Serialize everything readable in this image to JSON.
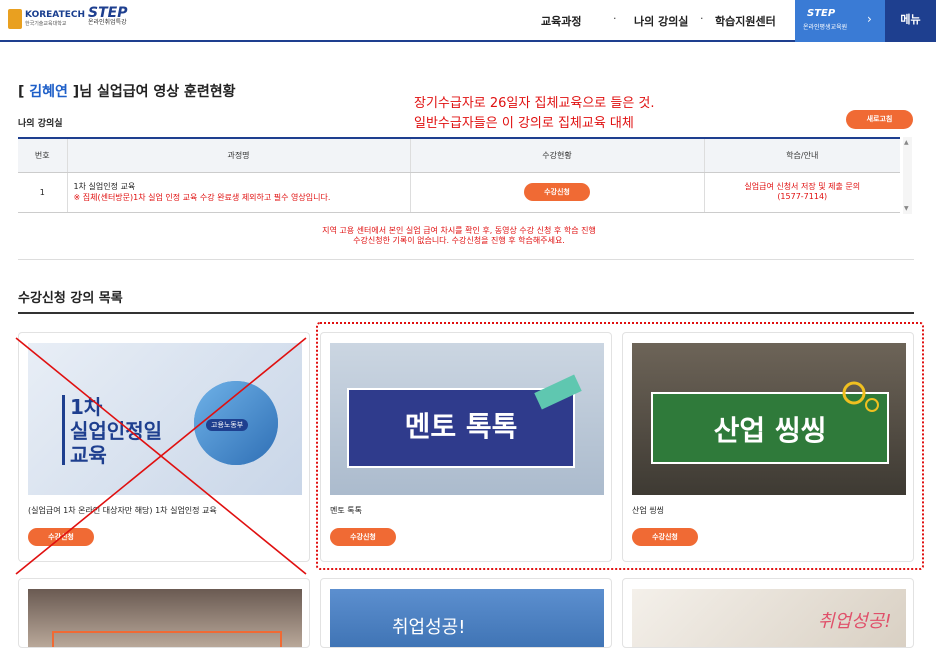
{
  "header": {
    "logo_koreatech": "KOREATECH",
    "logo_koreatech_sub": "한국기술교육대학교",
    "logo_step": "STEP",
    "logo_step_sub": "온라인취업특강",
    "nav": [
      "교육과정",
      "나의 강의실",
      "학습지원센터"
    ],
    "step_box": {
      "title": "STEP",
      "sub": "온라인평생교육원"
    },
    "menu": "메뉴",
    "accent": "#1e3f8f"
  },
  "page": {
    "name": "김혜연",
    "title_suffix": "님 실업급여 영상 훈련현황",
    "annotation": [
      "장기수급자로 26일자 집체교육으로 들은 것.",
      "일반수급자들은 이 강의로 집체교육 대체"
    ],
    "classroom_label": "나의 강의실",
    "refresh_button": "새로고침",
    "table": {
      "headers": [
        "번호",
        "과정명",
        "수강현황",
        "학습/안내"
      ],
      "rows": [
        {
          "no": "1",
          "course": "1차 실업인정 교육",
          "course_note": "※ 집체(센터방문)1차 실업 인정 교육 수강 완료생 제외하고 필수 영상입니다.",
          "status_button": "수강신청",
          "guide_line1": "실업급여 신청서 저장 및 제출 문의",
          "guide_line2": "(1577-7114)"
        }
      ]
    },
    "notice_line1": "지역 고용 센터에서 본인 실업 급여 차시를 확인 후, 동영상 수강 신청 후 학습 진행",
    "notice_line2": "수강신청한 기록이 없습니다. 수강신청을 진행 후 학습해주세요.",
    "section_title": "수강신청 강의 목록"
  },
  "courses": [
    {
      "title": "(실업급여 1차 온라인 대상자만 해당) 1차 실업인정 교육",
      "thumb_lines": [
        "1차",
        "실업인정일",
        "교육"
      ],
      "badge": "고용노동부",
      "button": "수강신청"
    },
    {
      "title": "멘토 톡톡",
      "thumb_text": "멘토 톡톡",
      "button": "수강신청"
    },
    {
      "title": "산업 씽씽",
      "thumb_text": "산업 씽씽",
      "button": "수강신청"
    }
  ],
  "bottom_cards": [
    {
      "thumb_text": ""
    },
    {
      "thumb_text": "취업성공!"
    },
    {
      "thumb_text": "취업성공!"
    }
  ]
}
